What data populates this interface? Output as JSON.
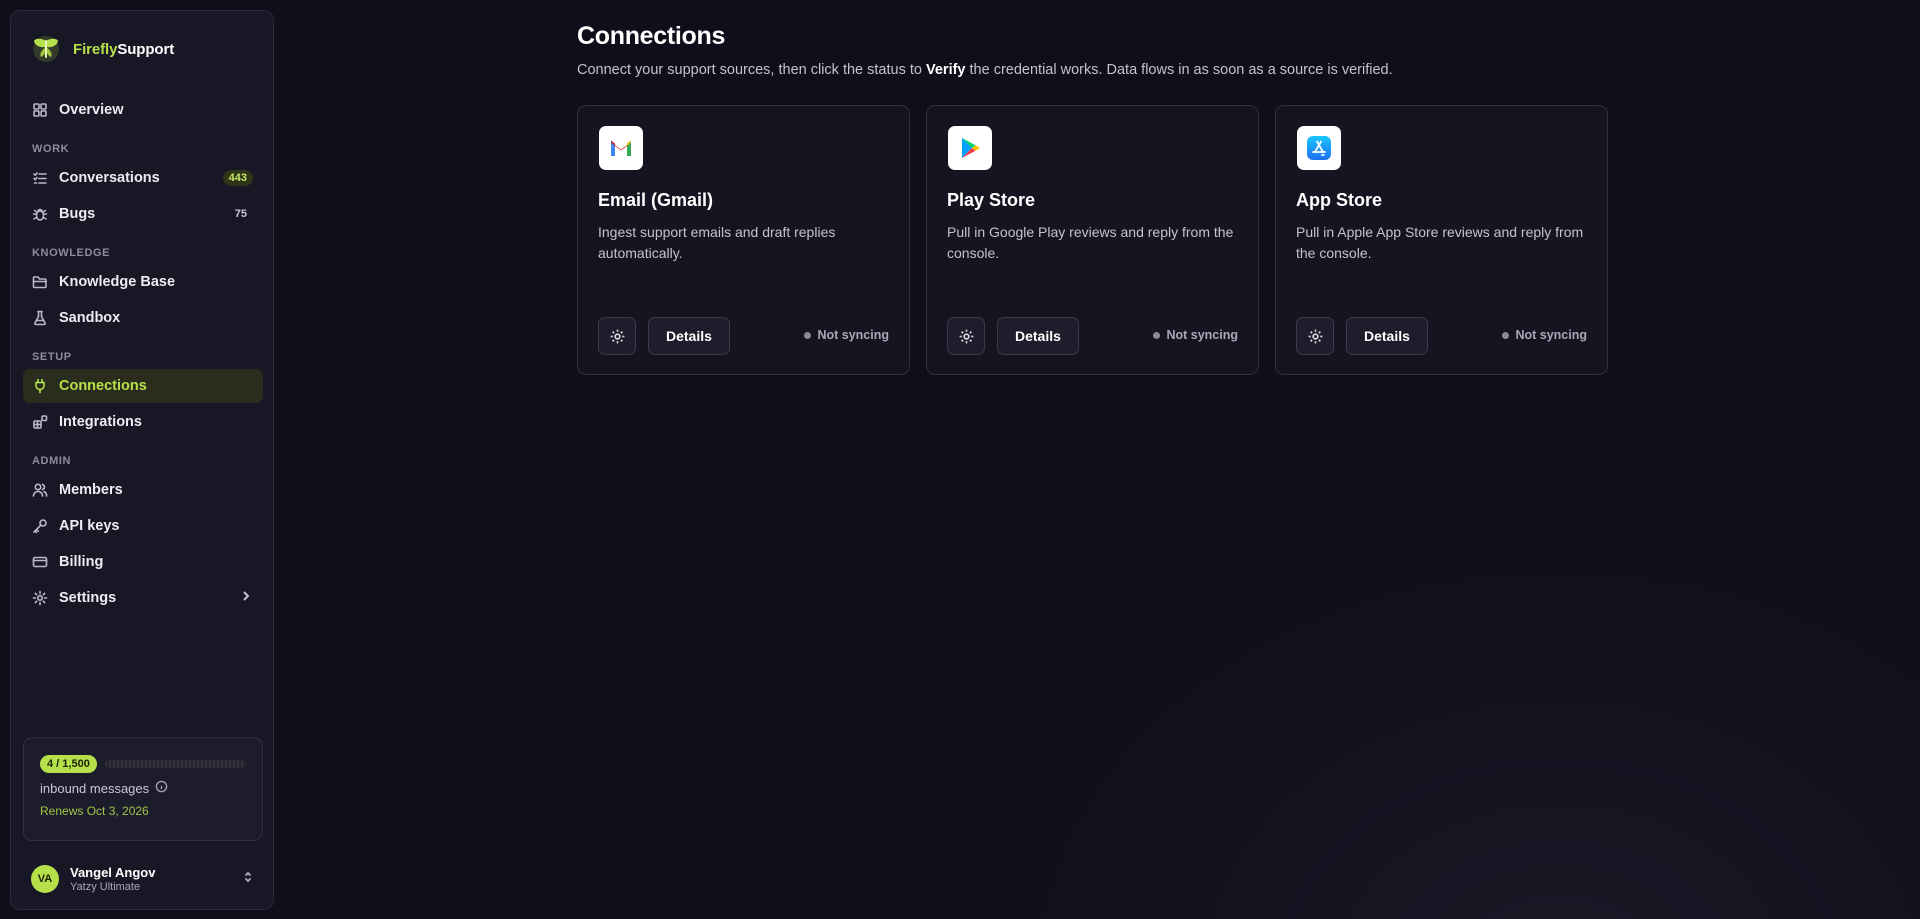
{
  "brand": {
    "name_part1": "Firefly",
    "name_part2": "Support",
    "accent": "#b6e04a"
  },
  "sidebar": {
    "overview": {
      "label": "Overview",
      "icon": "grid-icon"
    },
    "sections": {
      "work": "WORK",
      "knowledge": "KNOWLEDGE",
      "setup": "SETUP",
      "admin": "ADMIN"
    },
    "items": {
      "conversations": {
        "label": "Conversations",
        "count": "443",
        "icon": "list-check-icon"
      },
      "bugs": {
        "label": "Bugs",
        "count": "75",
        "icon": "bug-icon"
      },
      "knowledge_base": {
        "label": "Knowledge Base",
        "icon": "folder-icon"
      },
      "sandbox": {
        "label": "Sandbox",
        "icon": "flask-icon"
      },
      "connections": {
        "label": "Connections",
        "icon": "plug-icon",
        "active": true
      },
      "integrations": {
        "label": "Integrations",
        "icon": "blocks-icon"
      },
      "members": {
        "label": "Members",
        "icon": "users-icon"
      },
      "api_keys": {
        "label": "API keys",
        "icon": "key-icon"
      },
      "billing": {
        "label": "Billing",
        "icon": "credit-card-icon"
      },
      "settings": {
        "label": "Settings",
        "icon": "gear-icon"
      }
    },
    "usage": {
      "used_label": "4 / 1,500",
      "used": 4,
      "limit": 1500,
      "label": "inbound messages",
      "renews": "Renews Oct 3, 2026"
    },
    "user": {
      "initials": "VA",
      "name": "Vangel Angov",
      "plan": "Yatzy Ultimate"
    }
  },
  "main": {
    "title": "Connections",
    "subtitle_before": "Connect your support sources, then click the status to ",
    "subtitle_bold": "Verify",
    "subtitle_after": " the credential works. Data flows in as soon as a source is verified.",
    "cards": [
      {
        "title": "Email (Gmail)",
        "description": "Ingest support emails and draft replies automatically.",
        "icon": "gmail-icon",
        "details_label": "Details",
        "status": "Not syncing"
      },
      {
        "title": "Play Store",
        "description": "Pull in Google Play reviews and reply from the console.",
        "icon": "play-store-icon",
        "details_label": "Details",
        "status": "Not syncing"
      },
      {
        "title": "App Store",
        "description": "Pull in Apple App Store reviews and reply from the console.",
        "icon": "app-store-icon",
        "details_label": "Details",
        "status": "Not syncing"
      }
    ]
  }
}
